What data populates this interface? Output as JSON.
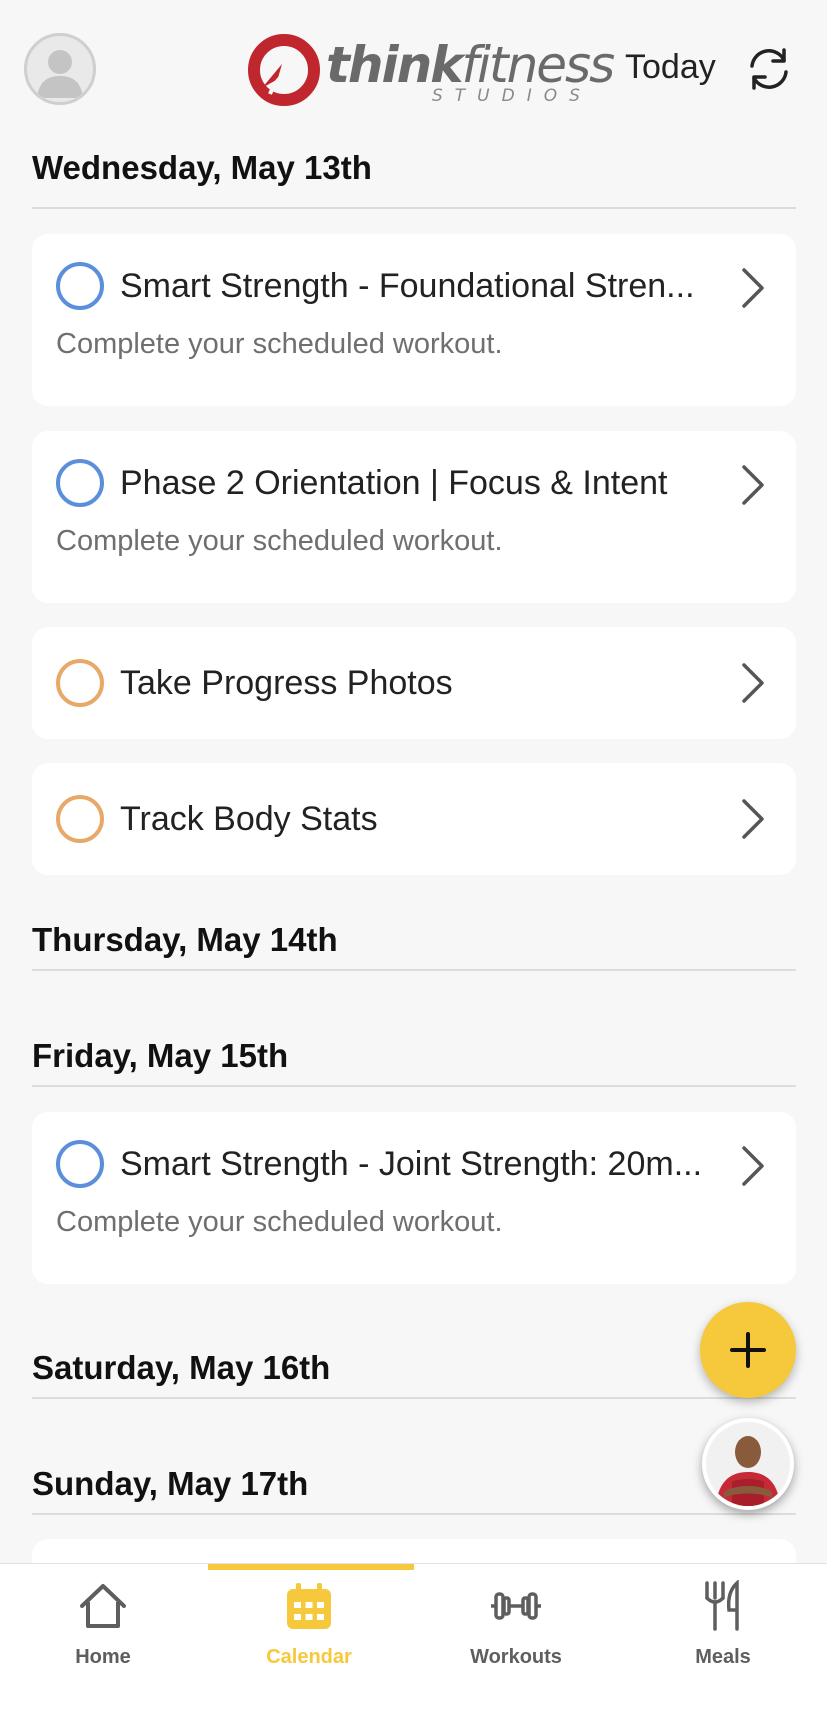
{
  "header": {
    "logo_primary": "think",
    "logo_secondary": "fitness",
    "logo_sub": "STUDIOS",
    "today_label": "Today",
    "avatar_icon": "user-avatar-icon",
    "refresh_icon": "refresh-icon"
  },
  "days": [
    {
      "title": "Wednesday, May 13th",
      "items": [
        {
          "title": "Smart Strength - Foundational Stren...",
          "subtitle": "Complete your scheduled workout.",
          "ring": "#5b8fdb"
        },
        {
          "title": "Phase 2 Orientation | Focus & Intent",
          "subtitle": "Complete your scheduled workout.",
          "ring": "#5b8fdb"
        },
        {
          "title": "Take Progress Photos",
          "ring": "#e8a868"
        },
        {
          "title": "Track Body Stats",
          "ring": "#e8a868"
        }
      ]
    },
    {
      "title": "Thursday, May 14th",
      "items": []
    },
    {
      "title": "Friday, May 15th",
      "items": [
        {
          "title": "Smart Strength - Joint Strength: 20m...",
          "subtitle": "Complete your scheduled workout.",
          "ring": "#5b8fdb"
        }
      ]
    },
    {
      "title": "Saturday, May 16th",
      "items": []
    },
    {
      "title": "Sunday, May 17th",
      "items": []
    }
  ],
  "fab_icon": "plus-icon",
  "coach_icon": "coach-avatar",
  "tabs": [
    {
      "label": "Home",
      "icon": "home-icon",
      "active": false
    },
    {
      "label": "Calendar",
      "icon": "calendar-icon",
      "active": true
    },
    {
      "label": "Workouts",
      "icon": "dumbbell-icon",
      "active": false
    },
    {
      "label": "Meals",
      "icon": "fork-knife-icon",
      "active": false
    }
  ],
  "colors": {
    "accent": "#f6c83b",
    "workout_ring": "#5b8fdb",
    "task_ring": "#e8a868",
    "logo_red": "#c0262d"
  }
}
